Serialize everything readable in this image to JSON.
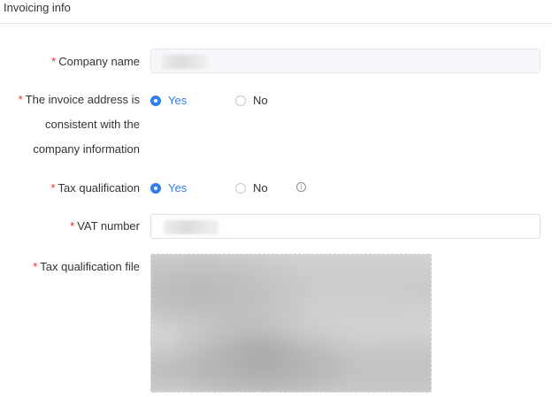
{
  "section": {
    "title": "Invoicing info"
  },
  "form": {
    "required_mark": "*",
    "company_name": {
      "label": "Company name",
      "value": ""
    },
    "invoice_address": {
      "label_lines": [
        "The invoice address is",
        "consistent with the",
        "company information"
      ],
      "options": [
        "Yes",
        "No"
      ],
      "selected": "Yes"
    },
    "tax_qualification": {
      "label": "Tax qualification",
      "options": [
        "Yes",
        "No"
      ],
      "selected": "Yes",
      "info_icon": "info-circle-icon",
      "info_glyph": "i"
    },
    "vat_number": {
      "label": "VAT number",
      "value": ""
    },
    "tax_qualification_file": {
      "label": "Tax qualification file"
    }
  },
  "colors": {
    "accent": "#2f80ed",
    "required": "#f5222d"
  }
}
